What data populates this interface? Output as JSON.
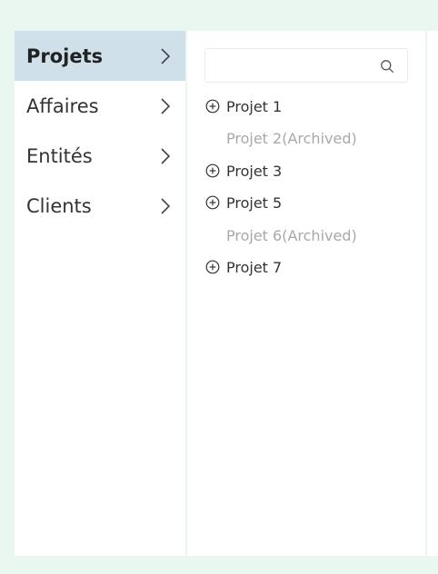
{
  "sidebar": {
    "items": [
      {
        "label": "Projets",
        "active": true
      },
      {
        "label": "Affaires",
        "active": false
      },
      {
        "label": "Entités",
        "active": false
      },
      {
        "label": "Clients",
        "active": false
      }
    ]
  },
  "search": {
    "value": "",
    "placeholder": ""
  },
  "projects": [
    {
      "label": "Projet 1",
      "archived": false
    },
    {
      "label": "Projet 2(Archived)",
      "archived": true
    },
    {
      "label": "Projet 3",
      "archived": false
    },
    {
      "label": "Projet 5",
      "archived": false
    },
    {
      "label": "Projet 6(Archived)",
      "archived": true
    },
    {
      "label": "Projet 7",
      "archived": false
    }
  ],
  "icons": {
    "nav_chevron": "chevron-right-icon",
    "search": "search-icon",
    "expand": "plus-circle-icon"
  },
  "colors": {
    "background": "#eaf6f0",
    "active_nav": "#cfe0ea",
    "archived_text": "#a8a8a8"
  }
}
